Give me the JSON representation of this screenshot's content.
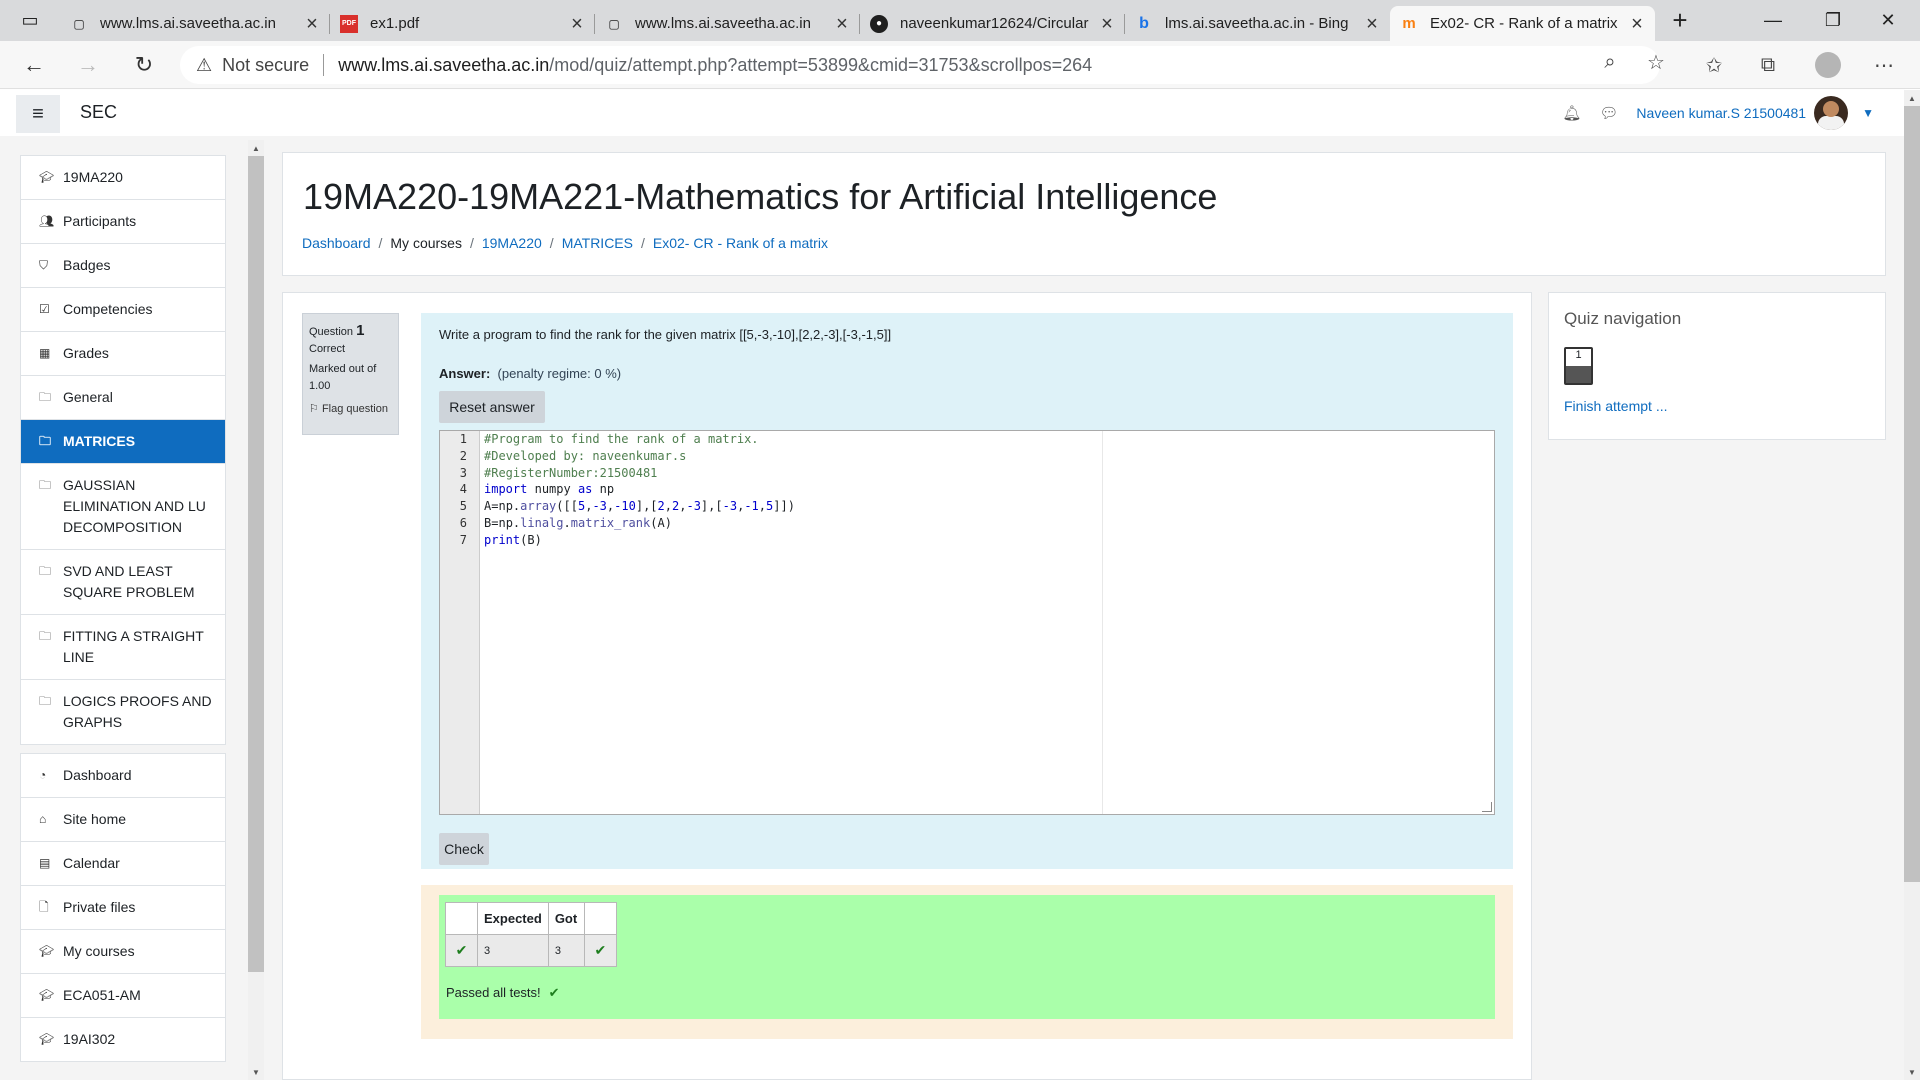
{
  "browser": {
    "tabs": [
      {
        "title": "www.lms.ai.saveetha.ac.in",
        "icon": "page-icon"
      },
      {
        "title": "ex1.pdf",
        "icon": "pdf-icon"
      },
      {
        "title": "www.lms.ai.saveetha.ac.in",
        "icon": "page-icon"
      },
      {
        "title": "naveenkumar12624/Circular",
        "icon": "github-icon"
      },
      {
        "title": "lms.ai.saveetha.ac.in - Bing",
        "icon": "bing-icon"
      },
      {
        "title": "Ex02- CR - Rank of a matrix",
        "icon": "moodle-icon",
        "active": true
      }
    ],
    "new_tab": "+",
    "security_label": "Not secure",
    "url_host": "www.lms.ai.saveetha.ac.in",
    "url_path": "/mod/quiz/attempt.php?attempt=53899&cmid=31753&scrollpos=264"
  },
  "header": {
    "site_name": "SEC",
    "user_name": "Naveen kumar.S 21500481"
  },
  "sidebar": {
    "course_items": [
      {
        "label": "19MA220",
        "icon": "graduation-cap-icon"
      },
      {
        "label": "Participants",
        "icon": "users-icon"
      },
      {
        "label": "Badges",
        "icon": "shield-icon"
      },
      {
        "label": "Competencies",
        "icon": "checkbox-icon"
      },
      {
        "label": "Grades",
        "icon": "table-icon"
      },
      {
        "label": "General",
        "icon": "folder-icon"
      },
      {
        "label": "MATRICES",
        "icon": "folder-icon",
        "active": true
      },
      {
        "label": "GAUSSIAN ELIMINATION AND LU DECOMPOSITION",
        "icon": "folder-icon"
      },
      {
        "label": "SVD AND LEAST SQUARE PROBLEM",
        "icon": "folder-icon"
      },
      {
        "label": "FITTING A STRAIGHT LINE",
        "icon": "folder-icon"
      },
      {
        "label": "LOGICS PROOFS AND GRAPHS",
        "icon": "folder-icon"
      }
    ],
    "site_items": [
      {
        "label": "Dashboard",
        "icon": "dashboard-icon"
      },
      {
        "label": "Site home",
        "icon": "home-icon"
      },
      {
        "label": "Calendar",
        "icon": "calendar-icon"
      },
      {
        "label": "Private files",
        "icon": "file-icon"
      },
      {
        "label": "My courses",
        "icon": "graduation-cap-icon"
      },
      {
        "label": "ECA051-AM",
        "icon": "graduation-cap-icon"
      },
      {
        "label": "19AI302",
        "icon": "graduation-cap-icon"
      }
    ]
  },
  "course": {
    "title": "19MA220-19MA221-Mathematics for Artificial Intelligence",
    "breadcrumb": [
      "Dashboard",
      "My courses",
      "19MA220",
      "MATRICES",
      "Ex02- CR - Rank of a matrix"
    ]
  },
  "question": {
    "label": "Question",
    "number": "1",
    "state": "Correct",
    "marked_out_of": "Marked out of 1.00",
    "flag_label": "Flag question",
    "text": "Write a program to find the rank for the given matrix [[5,-3,-10],[2,2,-3],[-3,-1,5]]",
    "answer_label": "Answer:",
    "penalty": "(penalty regime: 0 %)",
    "reset_label": "Reset answer",
    "check_label": "Check",
    "code_lines": [
      "#Program to find the rank of a matrix.",
      "#Developed by: naveenkumar.s",
      "#RegisterNumber:21500481",
      "import numpy as np",
      "A=np.array([[5,-3,-10],[2,2,-3],[-3,-1,5]])",
      "B=np.linalg.matrix_rank(A)",
      "print(B)"
    ]
  },
  "results": {
    "headers": [
      "",
      "Expected",
      "Got",
      ""
    ],
    "rows": [
      {
        "expected": "3",
        "got": "3",
        "pass": true
      }
    ],
    "summary": "Passed all tests!"
  },
  "quiz_nav": {
    "title": "Quiz navigation",
    "questions": [
      "1"
    ],
    "finish_label": "Finish attempt ..."
  }
}
